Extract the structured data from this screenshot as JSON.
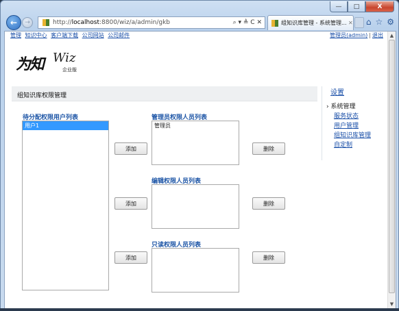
{
  "browser": {
    "address": "http://localhost:8800/wiz/a/admin/gkb",
    "address_host": "localhost",
    "address_prefix": "http://",
    "address_suffix": ":8800/wiz/a/admin/gkb",
    "address_icons": "⌕ ▾ ≜ C ✕",
    "tab_title": "组知识库管理 - 系统管理...",
    "tab_close": "✕",
    "window_min": "—",
    "window_max": "□",
    "window_close": "X",
    "back": "←",
    "forward": "→",
    "home_icon": "⌂",
    "star_icon": "☆",
    "gear_icon": "⚙"
  },
  "top_links": [
    "管理",
    "知识中心",
    "客户端下载",
    "公司网站",
    "公司邮件"
  ],
  "user_links": {
    "user": "管理员(admin)",
    "sep": "|",
    "logout": "退出"
  },
  "logo": {
    "cn": "为知",
    "en": "Wiz",
    "sub": "企业版"
  },
  "panel": {
    "title": "组知识库权限管理"
  },
  "pending": {
    "label": "待分配权限用户列表",
    "items": [
      "用户1"
    ],
    "selected_index": 0
  },
  "admin_list": {
    "label": "管理员权限人员列表",
    "items": [
      "管理员"
    ]
  },
  "edit_list": {
    "label": "编辑权限人员列表",
    "items": []
  },
  "read_list": {
    "label": "只读权限人员列表",
    "items": []
  },
  "buttons": {
    "add": "添加",
    "remove": "删除"
  },
  "sidebar": {
    "title": "设置",
    "section": "› 系统管理",
    "items": [
      "服务状态",
      "用户管理",
      "组知识库管理",
      "自定制"
    ]
  },
  "colors": {
    "link": "#1a4fa8",
    "selection": "#3399ff",
    "header_bg": "#eef0f2"
  }
}
